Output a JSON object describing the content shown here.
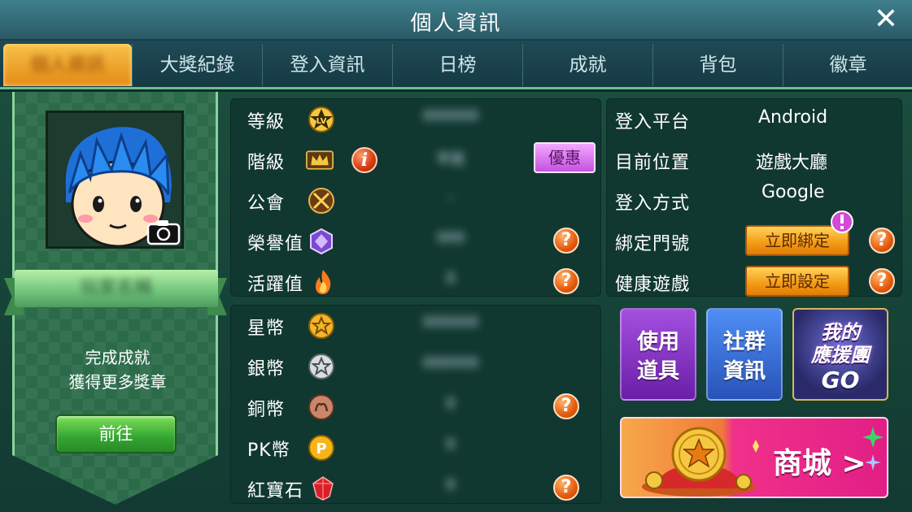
{
  "header": {
    "title": "個人資訊",
    "close_label": "✕"
  },
  "tabs": [
    {
      "label": "個人資訊",
      "active": true
    },
    {
      "label": "大獎紀錄"
    },
    {
      "label": "登入資訊"
    },
    {
      "label": "日榜"
    },
    {
      "label": "成就"
    },
    {
      "label": "背包"
    },
    {
      "label": "徽章"
    }
  ],
  "profile": {
    "name": "玩家名稱",
    "achievement_line1": "完成成就",
    "achievement_line2": "獲得更多獎章",
    "go_label": "前往"
  },
  "stats_top": [
    {
      "label": "等級",
      "value": "000000"
    },
    {
      "label": "階級",
      "value": "平民"
    },
    {
      "label": "公會",
      "value": "-"
    },
    {
      "label": "榮譽值",
      "value": "000"
    },
    {
      "label": "活躍值",
      "value": "0"
    }
  ],
  "discount_label": "優惠",
  "info_badge": "i",
  "help_label": "?",
  "stats_bottom": [
    {
      "label": "星幣",
      "value": "000000"
    },
    {
      "label": "銀幣",
      "value": "000000"
    },
    {
      "label": "銅幣",
      "value": "0"
    },
    {
      "label": "PK幣",
      "value": "0"
    },
    {
      "label": "紅寶石",
      "value": "0"
    }
  ],
  "login_info": [
    {
      "label": "登入平台",
      "value": "Android"
    },
    {
      "label": "目前位置",
      "value": "遊戲大廳"
    },
    {
      "label": "登入方式",
      "value": "Google"
    },
    {
      "label": "綁定門號",
      "button": "立即綁定"
    },
    {
      "label": "健康遊戲",
      "button": "立即設定"
    }
  ],
  "features": {
    "items_line1": "使用",
    "items_line2": "道具",
    "social_line1": "社群",
    "social_line2": "資訊",
    "cheer_line1": "我的",
    "cheer_line2": "應援團",
    "cheer_go": "GO",
    "shop_label": "商城 >"
  },
  "colors": {
    "header": "#3f7f8c",
    "tab_active": "#f39a14",
    "panel": "#113830",
    "banner_green": "#2b6b4a"
  }
}
